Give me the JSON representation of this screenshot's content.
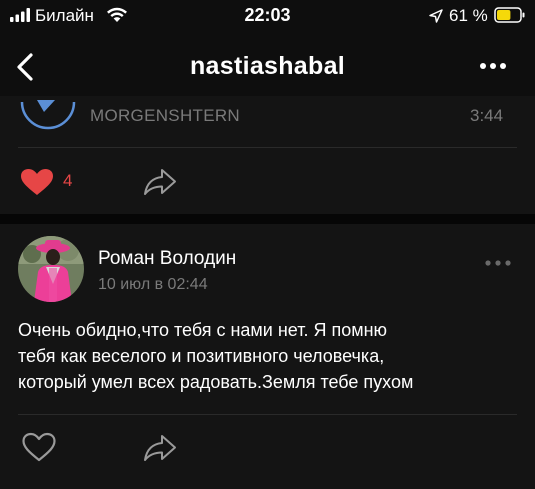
{
  "status_bar": {
    "carrier": "Билайн",
    "time": "22:03",
    "battery_percent": "61 %",
    "battery_level": 0.61
  },
  "nav": {
    "title": "nastiashabal"
  },
  "post_top": {
    "audio_artist": "MORGENSHTERN",
    "audio_duration": "3:44",
    "like_count": "4",
    "liked": true
  },
  "comment_post": {
    "author": "Роман Володин",
    "date": "10 июл в 02:44",
    "text_lines": [
      "Очень обидно,что тебя с нами нет. Я помню",
      "тебя как веселого и позитивного человечка,",
      "который умел всех радовать.Земля тебе пухом"
    ],
    "liked": false
  },
  "colors": {
    "background": "#000000",
    "card": "#141414",
    "secondary_text": "#7a7a7a",
    "like_red": "#e64646",
    "battery_yellow": "#f5d90a"
  }
}
